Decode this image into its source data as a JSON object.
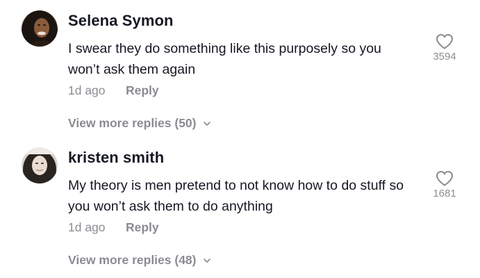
{
  "comments": [
    {
      "username": "Selena Symon",
      "text": "I swear they do something like this purposely so you won’t ask them again",
      "time": "1d ago",
      "reply_label": "Reply",
      "view_more": "View more replies (50)",
      "likes": "3594",
      "avatar_icon": "user-avatar-photo"
    },
    {
      "username": "kristen smith",
      "text": "My theory is men pretend to not know how to do stuff so you won’t ask them to do anything",
      "time": "1d ago",
      "reply_label": "Reply",
      "view_more": "View more replies (48)",
      "likes": "1681",
      "avatar_icon": "user-avatar-photo"
    }
  ],
  "colors": {
    "primary_text": "#161823",
    "secondary_text": "#8a8b91",
    "background": "#ffffff"
  },
  "icons": {
    "like": "heart-outline-icon",
    "expand": "chevron-down-icon"
  }
}
